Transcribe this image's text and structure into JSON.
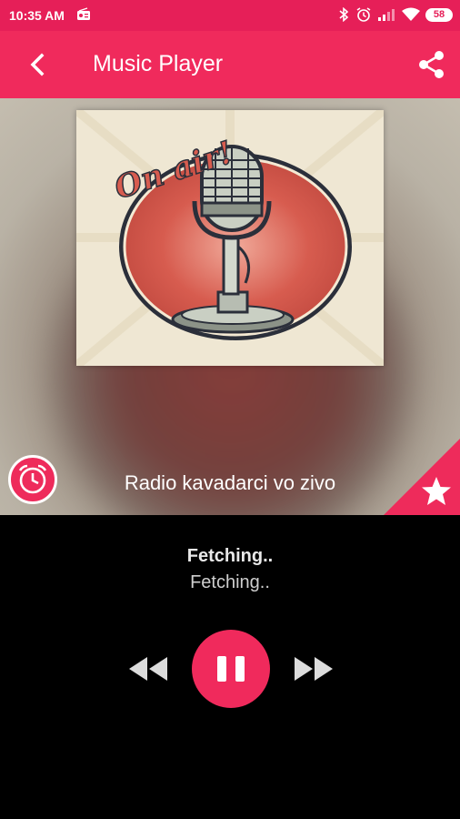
{
  "status_bar": {
    "time": "10:35 AM",
    "battery": "58",
    "icons": [
      "radio-icon",
      "bluetooth-icon",
      "alarm-icon",
      "signal-icon",
      "wifi-icon",
      "battery-icon"
    ]
  },
  "app_bar": {
    "title": "Music Player",
    "back_icon": "back-arrow-icon",
    "share_icon": "share-icon"
  },
  "hero": {
    "album_art": {
      "caption": "On air!"
    },
    "station_name": "Radio kavadarci vo zivo",
    "alarm_icon": "alarm-clock-icon",
    "favorite_icon": "star-icon"
  },
  "player": {
    "track_title": "Fetching..",
    "track_artist": "Fetching..",
    "controls": {
      "rewind_icon": "rewind-icon",
      "pause_icon": "pause-icon",
      "forward_icon": "fast-forward-icon"
    }
  },
  "colors": {
    "accent": "#f02a5c",
    "status_bar": "#e61f58",
    "player_bg": "#000000"
  }
}
